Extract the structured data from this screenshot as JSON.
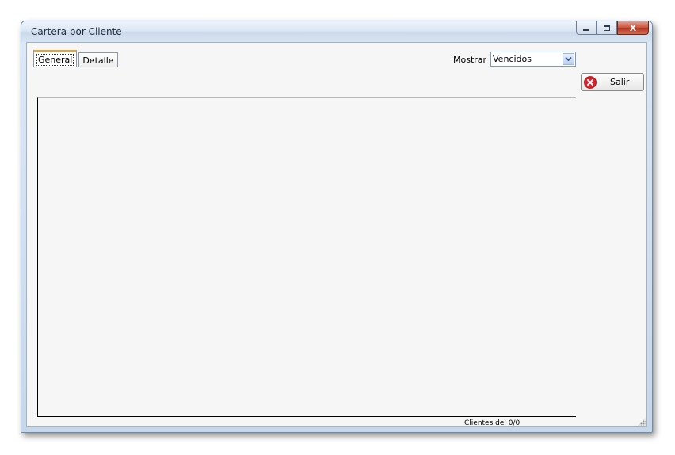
{
  "window": {
    "title": "Cartera por Cliente",
    "close_glyph": "X"
  },
  "tabs": [
    {
      "label": "General",
      "active": true
    },
    {
      "label": "Detalle",
      "active": false
    }
  ],
  "filter": {
    "label": "Mostrar",
    "selected": "Vencidos"
  },
  "buttons": {
    "salir": "Salir"
  },
  "status": {
    "label": "Clientes del",
    "value": "0/0"
  },
  "icons": {
    "salir": "error-x-icon",
    "dropdown": "chevron-down-icon"
  },
  "colors": {
    "active_tab_accent": "#f0a030",
    "salir_icon": "#d8232a",
    "dropdown_arrow": "#2c4f8c"
  }
}
